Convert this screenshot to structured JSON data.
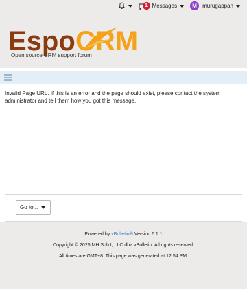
{
  "topbar": {
    "messages_badge": "1",
    "messages_label": "Messages",
    "avatar_letter": "M",
    "username": "murugappan"
  },
  "header": {
    "logo_text_espo": "Espo",
    "logo_text_crm": "CRM",
    "tagline": "Open source CRM support forum",
    "colors": {
      "logo_brown": "#8c3a0f",
      "logo_orange": "#f5a21a"
    }
  },
  "content": {
    "message": "Invalid Page URL. If this is an error and the page should exist, please contact the system administrator and tell them how you got this message."
  },
  "goto": {
    "label": "Go to..."
  },
  "footer": {
    "powered_prefix": "Powered by ",
    "powered_link": "vBulletin®",
    "powered_suffix": " Version 6.1.1",
    "copyright": "Copyright © 2025 MH Sub I, LLC dba vBulletin. All rights reserved.",
    "times": "All times are GMT+8. This page was generated at 12:54 PM."
  }
}
